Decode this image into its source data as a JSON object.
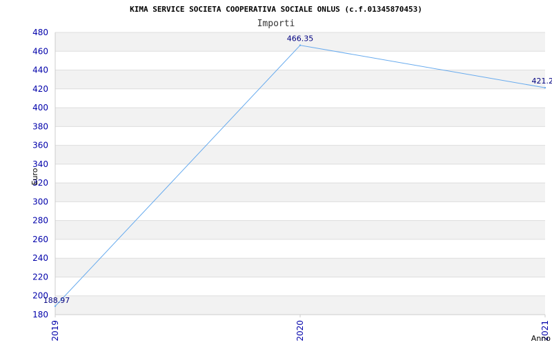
{
  "chart_data": {
    "type": "line",
    "title": "KIMA SERVICE SOCIETA COOPERATIVA SOCIALE ONLUS (c.f.01345870453)",
    "subtitle": "Importi",
    "xlabel": "Anno",
    "ylabel": "Euro",
    "categories": [
      "2019",
      "2020",
      "2021"
    ],
    "values": [
      188.97,
      466.35,
      421.2
    ],
    "data_labels": [
      "188.97",
      "466.35",
      "421.2"
    ],
    "ylim": [
      180,
      480
    ],
    "yticks": [
      180,
      200,
      220,
      240,
      260,
      280,
      300,
      320,
      340,
      360,
      380,
      400,
      420,
      440,
      460,
      480
    ],
    "grid": true,
    "band_colors": [
      "#f2f2f2",
      "#ffffff"
    ],
    "line_color": "#66aaee",
    "tick_color": "#0000aa"
  }
}
